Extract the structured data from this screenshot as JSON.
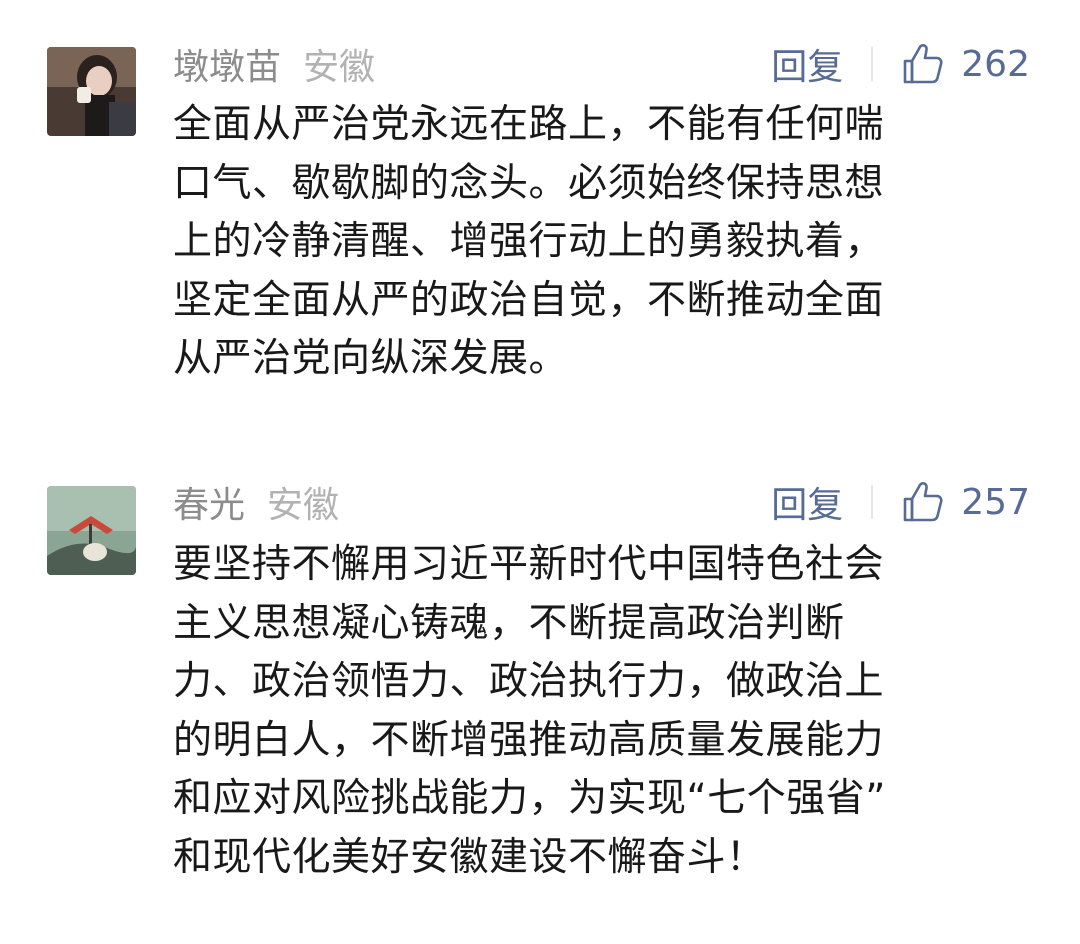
{
  "comments": [
    {
      "nickname": "墩墩苗",
      "location": "安徽",
      "reply_label": "回复",
      "like_count": "262",
      "avatar": "woman-photo-avatar",
      "lines": [
        "全面从严治党永远在路上，不能有任何喘",
        "口气、歇歇脚的念头。必须始终保持思想",
        "上的冷静清醒、增强行动上的勇毅执着，",
        "坚定全面从严的政治自觉，不断推动全面",
        "从严治党向纵深发展。"
      ]
    },
    {
      "nickname": "春光",
      "location": "安徽",
      "reply_label": "回复",
      "like_count": "257",
      "avatar": "painting-avatar",
      "lines": [
        "要坚持不懈用习近平新时代中国特色社会",
        "主义思想凝心铸魂，不断提高政治判断",
        "力、政治领悟力、政治执行力，做政治上",
        "的明白人，不断增强推动高质量发展能力",
        "和应对风险挑战能力，为实现“七个强省”",
        "和现代化美好安徽建设不懈奋斗！"
      ]
    }
  ],
  "colors": {
    "link": "#576b95",
    "meta": "#b2b2b2",
    "text": "#191919"
  },
  "icons": {
    "like": "thumbs-up-icon"
  }
}
